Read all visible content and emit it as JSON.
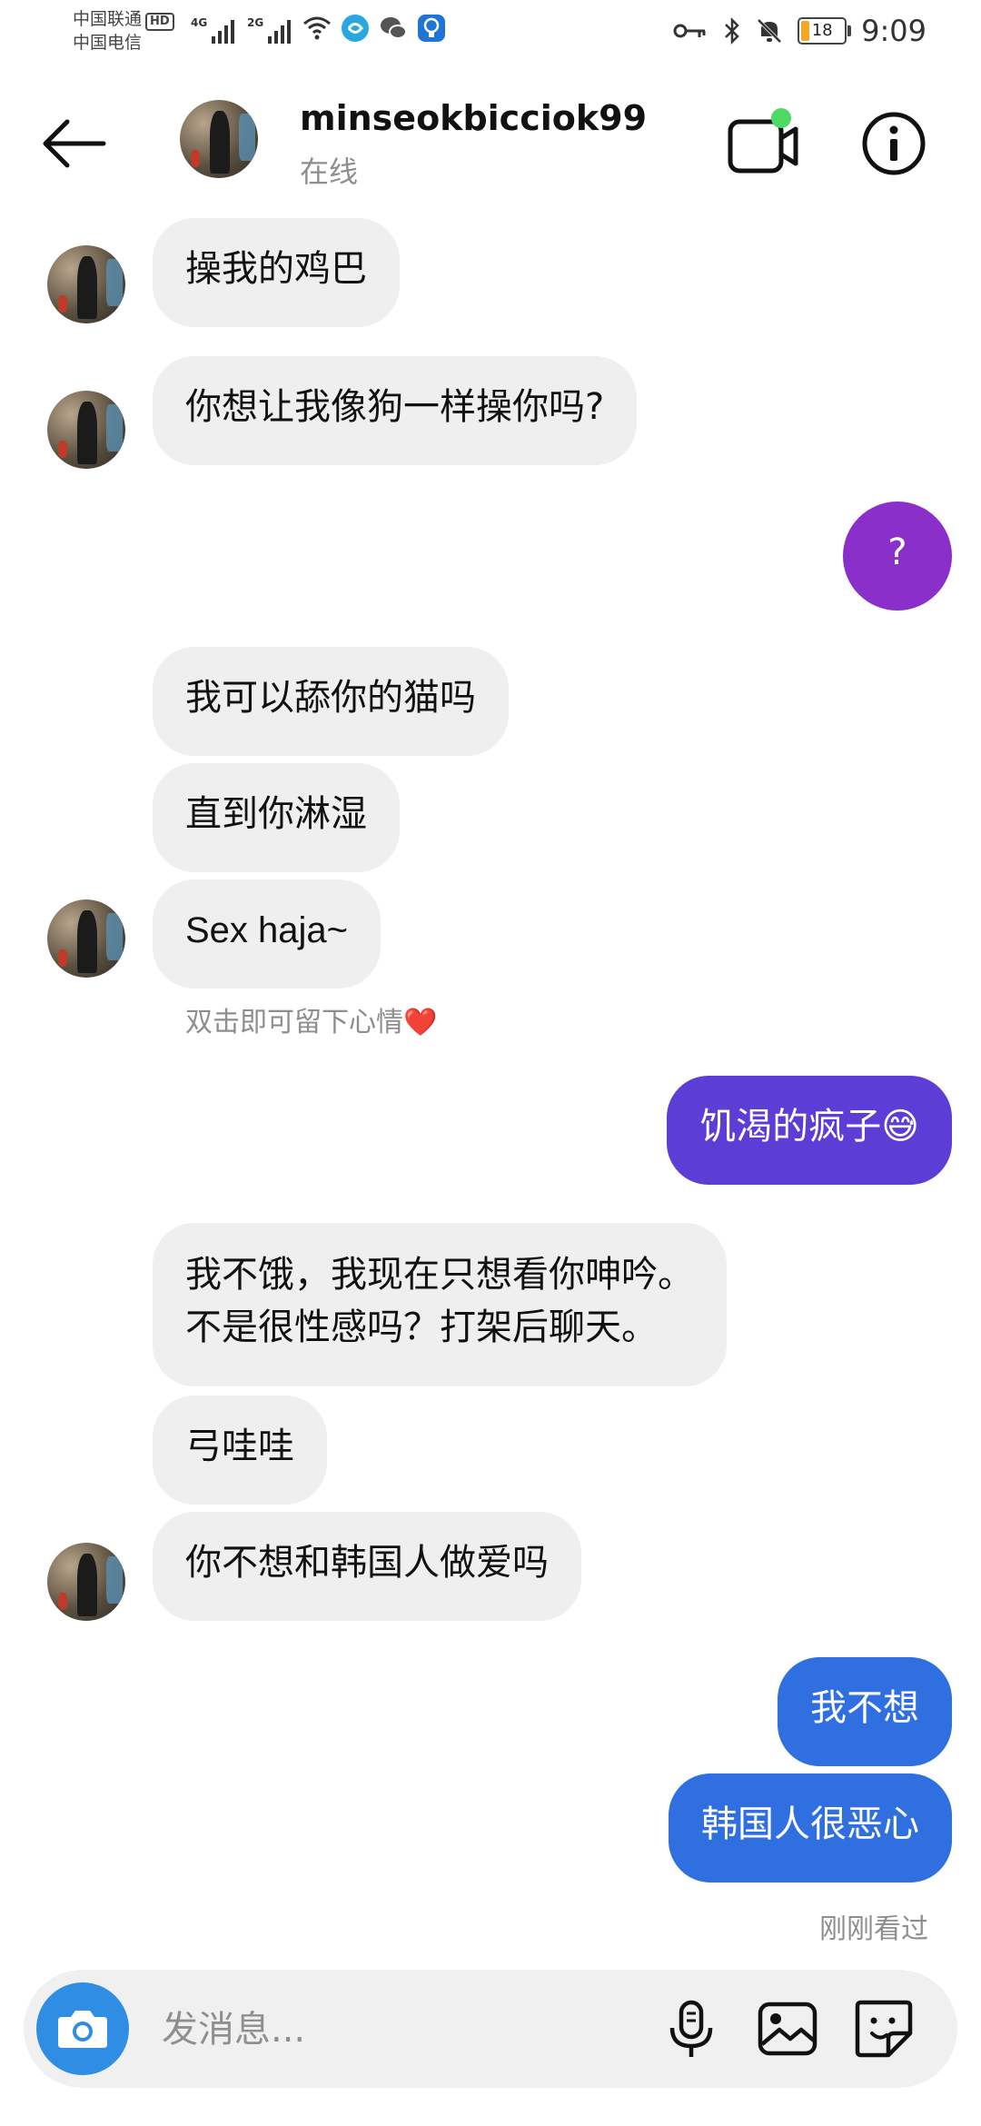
{
  "status_bar": {
    "carrier_1": "中国联通",
    "carrier_1_badge": "HD",
    "carrier_2": "中国电信",
    "signal_1_label": "4G",
    "signal_2_label": "2G",
    "battery": "18",
    "time": "9:09"
  },
  "header": {
    "username": "minseokbicciok99",
    "presence": "在线"
  },
  "messages": [
    {
      "side": "in",
      "text": "操我的鸡巴"
    },
    {
      "side": "in",
      "text": "你想让我像狗一样操你吗?"
    },
    {
      "side": "out",
      "text": "?"
    },
    {
      "side": "in",
      "text": "我可以舔你的猫吗"
    },
    {
      "side": "in",
      "text": "直到你淋湿"
    },
    {
      "side": "in",
      "text": "Sex haja~"
    },
    {
      "side": "out",
      "text": "饥渴的疯子😅"
    },
    {
      "side": "in",
      "text": "我不饿，我现在只想看你呻吟。\n不是很性感吗？打架后聊天。"
    },
    {
      "side": "in",
      "text": "弓哇哇"
    },
    {
      "side": "in",
      "text": "你不想和韩国人做爱吗"
    },
    {
      "side": "out",
      "text": "我不想"
    },
    {
      "side": "out",
      "text": "韩国人很恶心"
    }
  ],
  "reaction_hint": "双击即可留下心情",
  "reaction_emoji": "❤️",
  "seen_status": "刚刚看过",
  "composer": {
    "placeholder": "发消息..."
  },
  "colors": {
    "out_purple": "#8a2fc9",
    "out_indigo": "#5c3ed6",
    "out_blue": "#2f6fe0",
    "in_bubble": "#efefef",
    "camera": "#2f8de4",
    "online_dot": "#4cd964"
  },
  "icons": [
    "back-arrow-icon",
    "video-call-icon",
    "info-icon",
    "camera-icon",
    "microphone-icon",
    "gallery-icon",
    "sticker-icon"
  ]
}
